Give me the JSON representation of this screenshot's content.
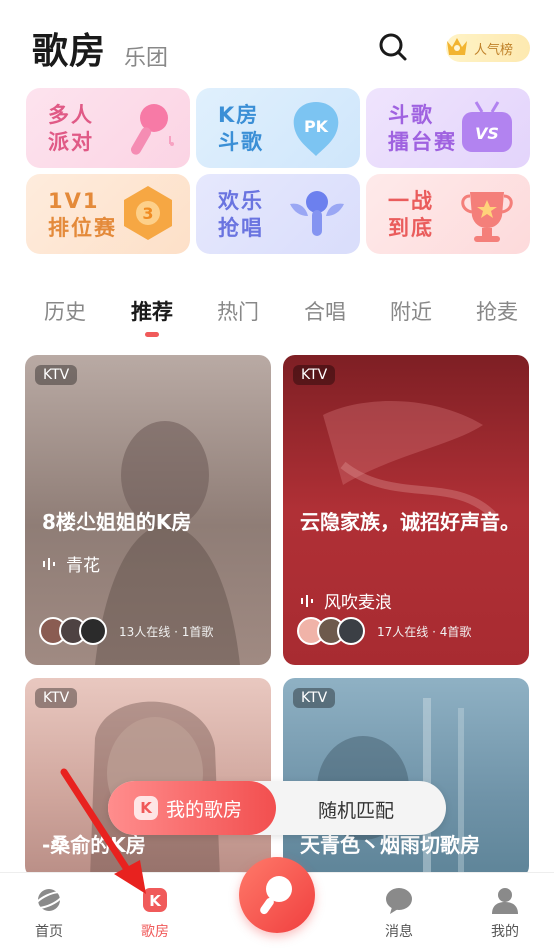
{
  "header": {
    "title": "歌房",
    "subtitle": "乐团",
    "rank_label": "人气榜"
  },
  "features": [
    {
      "label": "多人派对",
      "line1": "多人",
      "line2": "派对"
    },
    {
      "label": "K房斗歌",
      "line1": "K房",
      "line2": "斗歌",
      "badge": "PK"
    },
    {
      "label": "斗歌擂台赛",
      "line1": "斗歌",
      "line2": "擂台赛",
      "badge": "VS"
    },
    {
      "label": "1V1排位赛",
      "line1": "1V1",
      "line2": "排位赛"
    },
    {
      "label": "欢乐抢唱",
      "line1": "欢乐",
      "line2": "抢唱"
    },
    {
      "label": "一战到底",
      "line1": "一战",
      "line2": "到底"
    }
  ],
  "tabs": [
    "历史",
    "推荐",
    "热门",
    "合唱",
    "附近",
    "抢麦"
  ],
  "active_tab": "推荐",
  "rooms": [
    {
      "tag": "KTV",
      "name": "8楼尐姐姐的K房",
      "song": "青花",
      "meta": "13人在线 · 1首歌"
    },
    {
      "tag": "KTV",
      "name": "云隐家族，诚招好声音。",
      "song": "风吹麦浪",
      "meta": "17人在线 · 4首歌"
    },
    {
      "tag": "KTV",
      "name": "-桑俞的K房"
    },
    {
      "tag": "KTV",
      "name": "天青色丶烟雨切歌房"
    }
  ],
  "pill": {
    "mine_label": "我的歌房",
    "random_label": "随机匹配"
  },
  "nav": {
    "home": "首页",
    "karaoke": "歌房",
    "messages": "消息",
    "me": "我的"
  },
  "colors": {
    "accent": "#f05a5a"
  }
}
